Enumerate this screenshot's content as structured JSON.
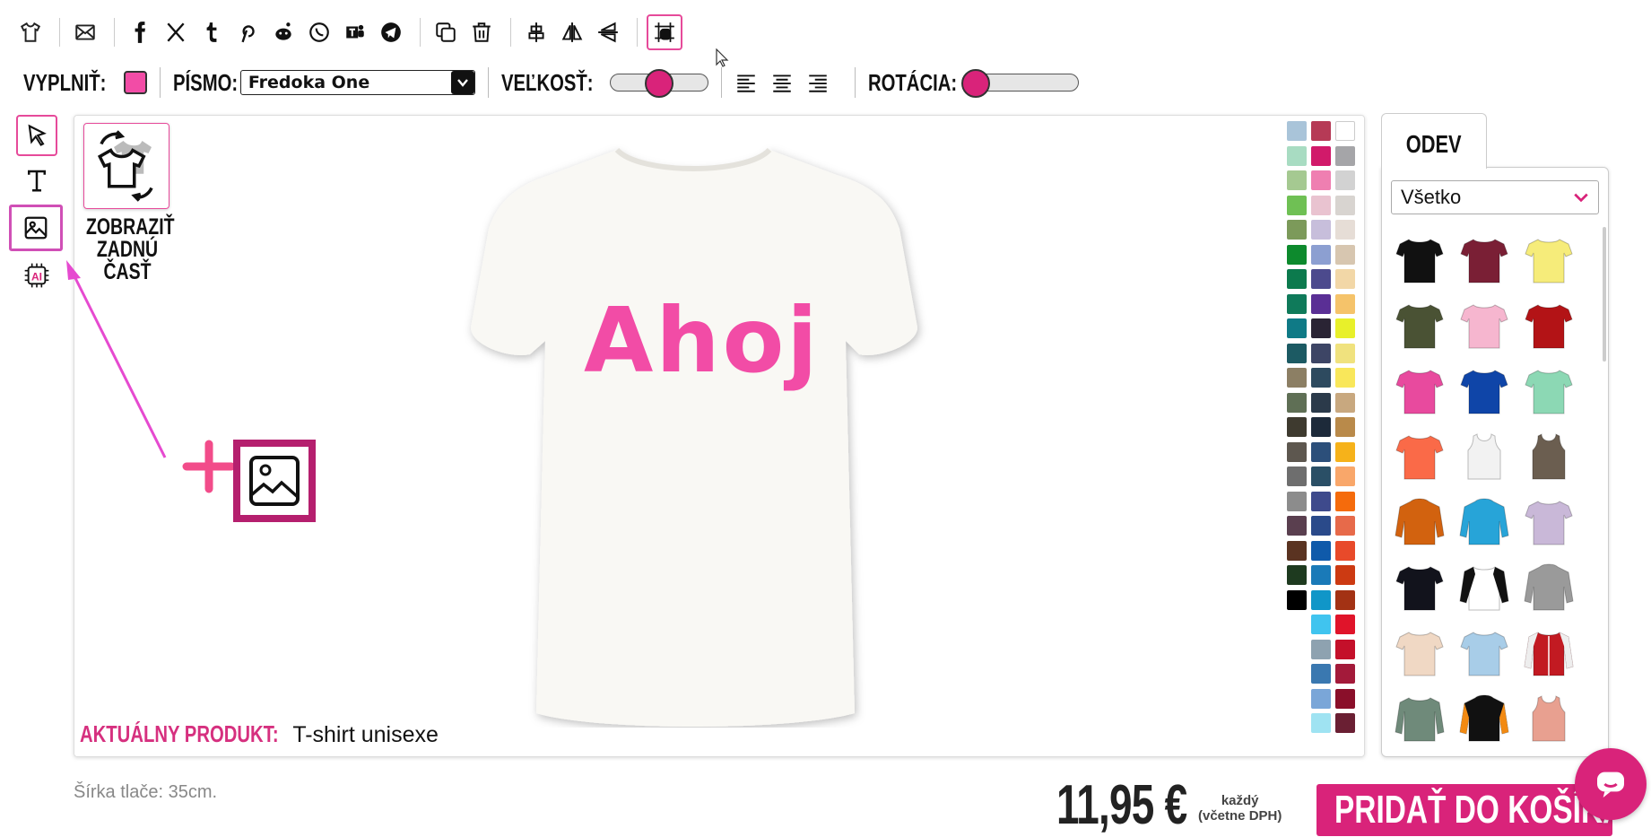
{
  "toolbar2": {
    "fill_label": "VYPLNIŤ:",
    "font_label": "PÍSMO:",
    "font_value": "Fredoka One",
    "size_label": "VEĽKOSŤ:",
    "size_value": 0.5,
    "rotation_label": "ROTÁCIA:",
    "rotation_value": 0.0,
    "fill_color": "#f24ca6"
  },
  "top_icons": [
    "shirt-icon",
    "email-icon",
    "facebook-icon",
    "x-icon",
    "tumblr-icon",
    "pinterest-icon",
    "reddit-icon",
    "whatsapp-icon",
    "teams-icon",
    "telegram-icon",
    "duplicate-icon",
    "trash-icon",
    "align-center-vertical-icon",
    "flip-horizontal-icon",
    "flip-vertical-icon",
    "grid-preview-icon"
  ],
  "canvas": {
    "back_view_label": "ZOBRAZIŤ ZADNÚ ČASŤ",
    "design_text": "Ahoj",
    "product_label": "AKTUÁLNY PRODUKT:",
    "product_name": "T-shirt unisexe"
  },
  "palette": [
    "#a9c4d9",
    "#b63a56",
    "#ffffff",
    "#a8dcc2",
    "#d11a6a",
    "#a5a5a8",
    "#a5c991",
    "#ef7fb1",
    "#d2d2d2",
    "#6fc054",
    "#e9c3d0",
    "#d8d4d0",
    "#7c9a5a",
    "#c7bedb",
    "#e6ddd6",
    "#0d8a2d",
    "#8c9fd1",
    "#d7c6b0",
    "#0c7a4d",
    "#4c4a8d",
    "#f2d7a7",
    "#0f7a5a",
    "#5a2f95",
    "#f5c36a",
    "#0f7a86",
    "#2a2434",
    "#e8f02a",
    "#1c5a63",
    "#3d4565",
    "#f0e27e",
    "#8c7f64",
    "#2d4a5f",
    "#f9e75a",
    "#5f6f55",
    "#2b3a4a",
    "#c8a87f",
    "#3e3a2f",
    "#1d2a3a",
    "#b98a4a",
    "#5d574f",
    "#2c4f7a",
    "#f6b21a",
    "#6e6e6e",
    "#2a4f66",
    "#f9a76a",
    "#8c8c8c",
    "#3e4a8c",
    "#f56b0c",
    "#5a3f4f",
    "#2a4a8a",
    "#e76a4a",
    "#5a3321",
    "#0f5aaa",
    "#e84a2a",
    "#1e3a1f",
    "#1a7ab8",
    "#cc3a12",
    "#000000",
    "#1096c8",
    "#a33214",
    null,
    "#40c4ef",
    "#e0142a",
    null,
    "#8ea2b0",
    "#c4102a",
    null,
    "#3a78b0",
    "#a31a3a",
    null,
    "#7aa6d8",
    "#8a0f2a",
    null,
    "#9fe3f2",
    "#6a1f33"
  ],
  "right_panel": {
    "tab_label": "ODEV",
    "category_value": "Všetko"
  },
  "products": [
    {
      "color": "#111111",
      "type": "tshirt"
    },
    {
      "color": "#7a1f35",
      "type": "tshirt"
    },
    {
      "color": "#f6ec7a",
      "type": "tshirt"
    },
    {
      "color": "#4a5234",
      "type": "tshirt"
    },
    {
      "color": "#f6b6cf",
      "type": "tshirt"
    },
    {
      "color": "#b31316",
      "type": "tshirt"
    },
    {
      "color": "#e84a9e",
      "type": "tshirt"
    },
    {
      "color": "#0f45a8",
      "type": "tshirt"
    },
    {
      "color": "#8cd8b4",
      "type": "tshirt"
    },
    {
      "color": "#fa6a48",
      "type": "tshirt"
    },
    {
      "color": "#f2f2f2",
      "type": "tank"
    },
    {
      "color": "#6b5e50",
      "type": "tank"
    },
    {
      "color": "#d2620f",
      "type": "hoodie"
    },
    {
      "color": "#27a4d8",
      "type": "hoodie"
    },
    {
      "color": "#c9b8d8",
      "type": "tshirt"
    },
    {
      "color": "#12131c",
      "type": "tshirt"
    },
    {
      "color": "#ffffff",
      "type": "raglan"
    },
    {
      "color": "#9a9a9a",
      "type": "hoodie"
    },
    {
      "color": "#f0d8c4",
      "type": "tshirt"
    },
    {
      "color": "#a8cde8",
      "type": "tshirt"
    },
    {
      "color": "#c21a22",
      "type": "jacket"
    },
    {
      "color": "#6f8a7a",
      "type": "longsleeve"
    },
    {
      "color": "#111111",
      "type": "hoodie"
    },
    {
      "color": "#e8a090",
      "type": "tank"
    }
  ],
  "footer": {
    "print_width": "Šírka tlače: 35cm.",
    "price": "11,95 €",
    "each_line1": "každý",
    "each_line2": "(včetne DPH)",
    "cart_button": "PRIDAŤ DO KOŠÍKA"
  },
  "colors": {
    "accent": "#d9237a",
    "pink": "#f24ca6",
    "border_pink": "#e64a9a"
  }
}
